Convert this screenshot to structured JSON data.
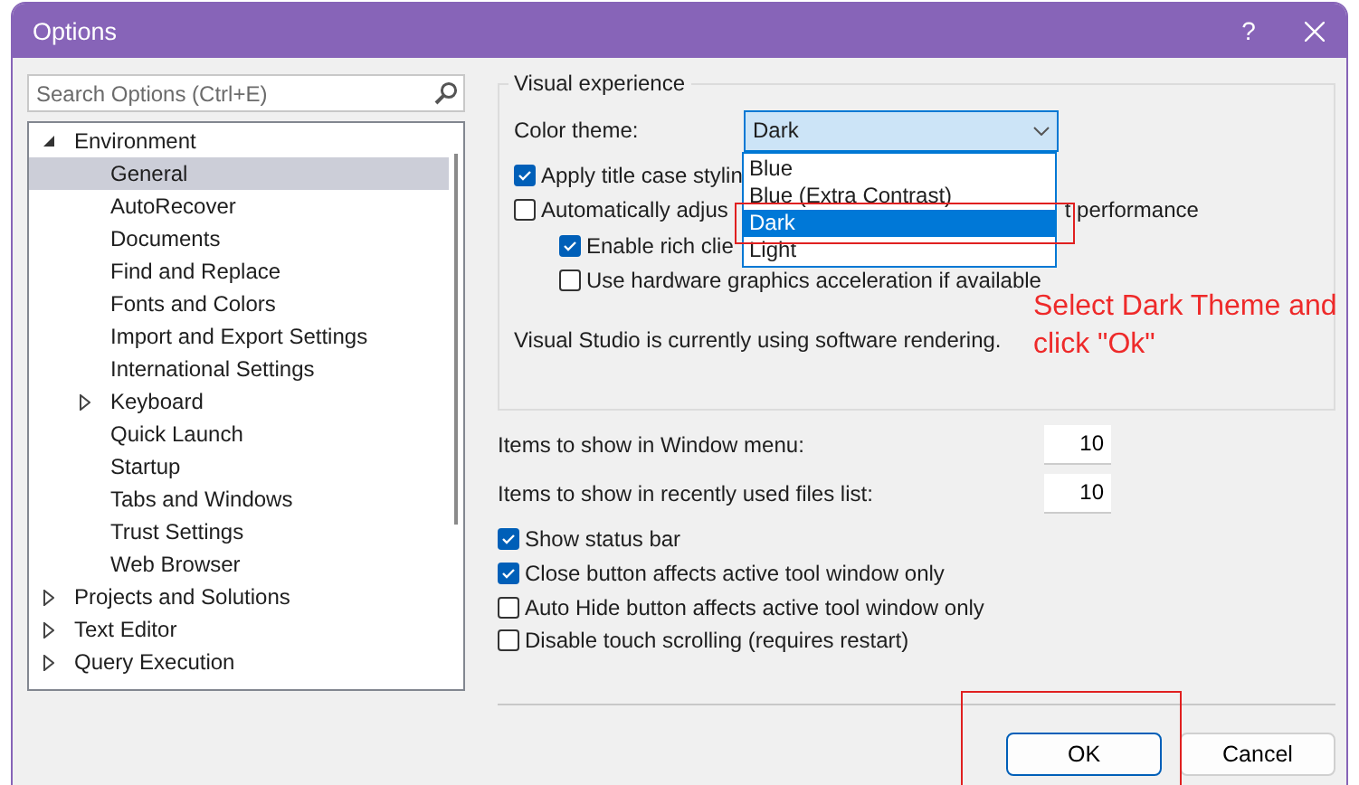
{
  "window": {
    "title": "Options",
    "help": "?"
  },
  "search": {
    "placeholder": "Search Options (Ctrl+E)"
  },
  "tree": [
    {
      "label": "Environment",
      "expanded": true,
      "selected": false,
      "children": [
        {
          "label": "General",
          "selected": true
        },
        {
          "label": "AutoRecover",
          "selected": false
        },
        {
          "label": "Documents",
          "selected": false
        },
        {
          "label": "Find and Replace",
          "selected": false
        },
        {
          "label": "Fonts and Colors",
          "selected": false
        },
        {
          "label": "Import and Export Settings",
          "selected": false
        },
        {
          "label": "International Settings",
          "selected": false
        },
        {
          "label": "Keyboard",
          "expanded": false,
          "selected": false
        },
        {
          "label": "Quick Launch",
          "selected": false
        },
        {
          "label": "Startup",
          "selected": false
        },
        {
          "label": "Tabs and Windows",
          "selected": false
        },
        {
          "label": "Trust Settings",
          "selected": false
        },
        {
          "label": "Web Browser",
          "selected": false
        }
      ]
    },
    {
      "label": "Projects and Solutions",
      "expanded": false,
      "selected": false
    },
    {
      "label": "Text Editor",
      "expanded": false,
      "selected": false
    },
    {
      "label": "Query Execution",
      "expanded": false,
      "selected": false
    }
  ],
  "visual_experience": {
    "legend": "Visual experience",
    "color_theme_label": "Color theme:",
    "color_theme_value": "Dark",
    "theme_options": [
      {
        "label": "Blue",
        "selected": false
      },
      {
        "label": "Blue (Extra Contrast)",
        "selected": false
      },
      {
        "label": "Dark",
        "selected": true
      },
      {
        "label": "Light",
        "selected": false
      }
    ],
    "options": [
      {
        "label": "Apply title case stylin",
        "checked": true
      },
      {
        "label": "Automatically adjus",
        "label_tail": "t performance",
        "checked": false,
        "children": [
          {
            "label": "Enable rich clie",
            "checked": true
          },
          {
            "label": "Use hardware graphics acceleration if available",
            "checked": false
          }
        ]
      }
    ],
    "note": "Visual Studio is currently using software rendering."
  },
  "counts": [
    {
      "label": "Items to show in Window menu:",
      "value": "10"
    },
    {
      "label": "Items to show in recently used files list:",
      "value": "10"
    }
  ],
  "options": [
    {
      "label": "Show status bar",
      "checked": true
    },
    {
      "label": "Close button affects active tool window only",
      "checked": true
    },
    {
      "label": "Auto Hide button affects active tool window only",
      "checked": false
    },
    {
      "label": "Disable touch scrolling (requires restart)",
      "checked": false
    }
  ],
  "buttons": [
    {
      "label": "OK",
      "kind": "primary"
    },
    {
      "label": "Cancel",
      "kind": "normal"
    }
  ],
  "annotation": {
    "text": "Select Dark Theme and click \"Ok\""
  }
}
